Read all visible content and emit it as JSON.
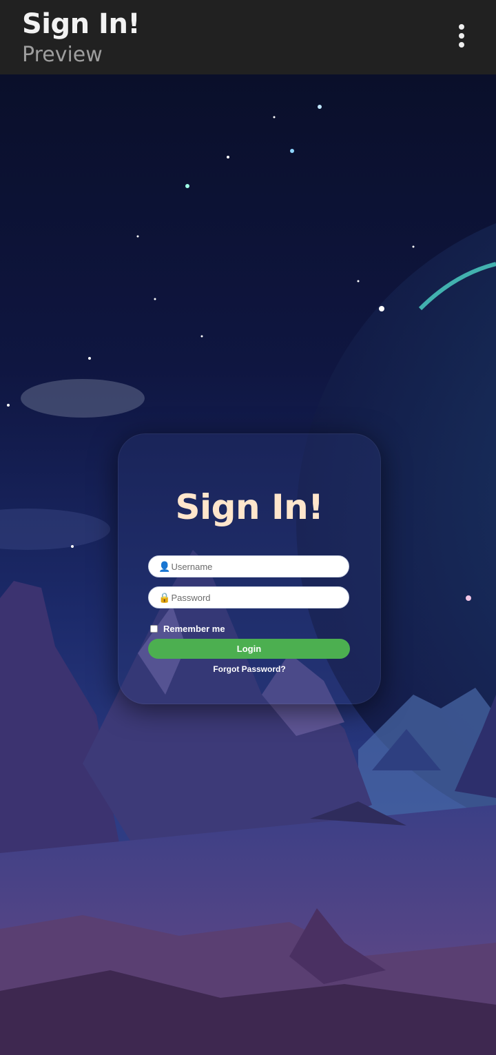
{
  "appbar": {
    "title": "Sign In!",
    "subtitle": "Preview",
    "menu_icon": "more-vert-icon"
  },
  "login": {
    "title": "Sign In!",
    "username_icon": "👤",
    "username_placeholder": "Username",
    "password_icon": "🔒",
    "password_placeholder": "Password",
    "remember_label": "Remember me",
    "login_label": "Login",
    "forgot_label": "Forgot Password?"
  },
  "colors": {
    "appbar_bg": "#212121",
    "title_color": "#ffe6cc",
    "login_button": "#4caf50"
  }
}
